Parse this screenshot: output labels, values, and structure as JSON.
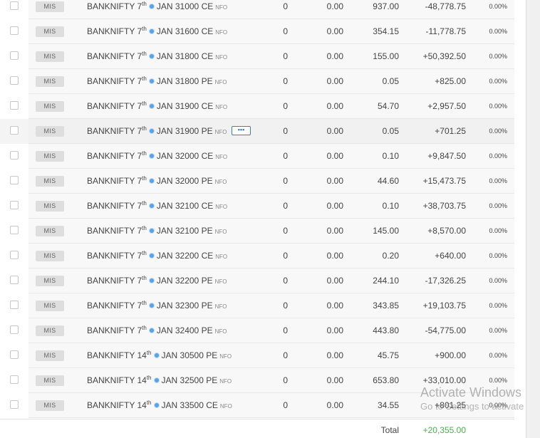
{
  "positions": [
    {
      "product": "MIS",
      "symbol": "BANKNIFTY",
      "day": "7",
      "suffix": "th",
      "month": "JAN",
      "strike": "31000",
      "opt": "CE",
      "exchange": "NFO",
      "qty": "0",
      "avg": "0.00",
      "ltp": "937.00",
      "pnl": "-48,778.75",
      "chg": "0.00%"
    },
    {
      "product": "MIS",
      "symbol": "BANKNIFTY",
      "day": "7",
      "suffix": "th",
      "month": "JAN",
      "strike": "31600",
      "opt": "CE",
      "exchange": "NFO",
      "qty": "0",
      "avg": "0.00",
      "ltp": "354.15",
      "pnl": "-11,778.75",
      "chg": "0.00%"
    },
    {
      "product": "MIS",
      "symbol": "BANKNIFTY",
      "day": "7",
      "suffix": "th",
      "month": "JAN",
      "strike": "31800",
      "opt": "CE",
      "exchange": "NFO",
      "qty": "0",
      "avg": "0.00",
      "ltp": "155.00",
      "pnl": "+50,392.50",
      "chg": "0.00%"
    },
    {
      "product": "MIS",
      "symbol": "BANKNIFTY",
      "day": "7",
      "suffix": "th",
      "month": "JAN",
      "strike": "31800",
      "opt": "PE",
      "exchange": "NFO",
      "qty": "0",
      "avg": "0.00",
      "ltp": "0.05",
      "pnl": "+825.00",
      "chg": "0.00%"
    },
    {
      "product": "MIS",
      "symbol": "BANKNIFTY",
      "day": "7",
      "suffix": "th",
      "month": "JAN",
      "strike": "31900",
      "opt": "CE",
      "exchange": "NFO",
      "qty": "0",
      "avg": "0.00",
      "ltp": "54.70",
      "pnl": "+2,957.50",
      "chg": "0.00%"
    },
    {
      "product": "MIS",
      "symbol": "BANKNIFTY",
      "day": "7",
      "suffix": "th",
      "month": "JAN",
      "strike": "31900",
      "opt": "PE",
      "exchange": "NFO",
      "qty": "0",
      "avg": "0.00",
      "ltp": "0.05",
      "pnl": "+701.25",
      "chg": "0.00%"
    },
    {
      "product": "MIS",
      "symbol": "BANKNIFTY",
      "day": "7",
      "suffix": "th",
      "month": "JAN",
      "strike": "32000",
      "opt": "CE",
      "exchange": "NFO",
      "qty": "0",
      "avg": "0.00",
      "ltp": "0.10",
      "pnl": "+9,847.50",
      "chg": "0.00%"
    },
    {
      "product": "MIS",
      "symbol": "BANKNIFTY",
      "day": "7",
      "suffix": "th",
      "month": "JAN",
      "strike": "32000",
      "opt": "PE",
      "exchange": "NFO",
      "qty": "0",
      "avg": "0.00",
      "ltp": "44.60",
      "pnl": "+15,473.75",
      "chg": "0.00%"
    },
    {
      "product": "MIS",
      "symbol": "BANKNIFTY",
      "day": "7",
      "suffix": "th",
      "month": "JAN",
      "strike": "32100",
      "opt": "CE",
      "exchange": "NFO",
      "qty": "0",
      "avg": "0.00",
      "ltp": "0.10",
      "pnl": "+38,703.75",
      "chg": "0.00%"
    },
    {
      "product": "MIS",
      "symbol": "BANKNIFTY",
      "day": "7",
      "suffix": "th",
      "month": "JAN",
      "strike": "32100",
      "opt": "PE",
      "exchange": "NFO",
      "qty": "0",
      "avg": "0.00",
      "ltp": "145.00",
      "pnl": "+8,570.00",
      "chg": "0.00%"
    },
    {
      "product": "MIS",
      "symbol": "BANKNIFTY",
      "day": "7",
      "suffix": "th",
      "month": "JAN",
      "strike": "32200",
      "opt": "CE",
      "exchange": "NFO",
      "qty": "0",
      "avg": "0.00",
      "ltp": "0.20",
      "pnl": "+640.00",
      "chg": "0.00%"
    },
    {
      "product": "MIS",
      "symbol": "BANKNIFTY",
      "day": "7",
      "suffix": "th",
      "month": "JAN",
      "strike": "32200",
      "opt": "PE",
      "exchange": "NFO",
      "qty": "0",
      "avg": "0.00",
      "ltp": "244.10",
      "pnl": "-17,326.25",
      "chg": "0.00%"
    },
    {
      "product": "MIS",
      "symbol": "BANKNIFTY",
      "day": "7",
      "suffix": "th",
      "month": "JAN",
      "strike": "32300",
      "opt": "PE",
      "exchange": "NFO",
      "qty": "0",
      "avg": "0.00",
      "ltp": "343.85",
      "pnl": "+19,103.75",
      "chg": "0.00%"
    },
    {
      "product": "MIS",
      "symbol": "BANKNIFTY",
      "day": "7",
      "suffix": "th",
      "month": "JAN",
      "strike": "32400",
      "opt": "PE",
      "exchange": "NFO",
      "qty": "0",
      "avg": "0.00",
      "ltp": "443.80",
      "pnl": "-54,775.00",
      "chg": "0.00%"
    },
    {
      "product": "MIS",
      "symbol": "BANKNIFTY",
      "day": "14",
      "suffix": "th",
      "month": "JAN",
      "strike": "30500",
      "opt": "PE",
      "exchange": "NFO",
      "qty": "0",
      "avg": "0.00",
      "ltp": "45.75",
      "pnl": "+900.00",
      "chg": "0.00%"
    },
    {
      "product": "MIS",
      "symbol": "BANKNIFTY",
      "day": "14",
      "suffix": "th",
      "month": "JAN",
      "strike": "32500",
      "opt": "PE",
      "exchange": "NFO",
      "qty": "0",
      "avg": "0.00",
      "ltp": "653.80",
      "pnl": "+33,010.00",
      "chg": "0.00%"
    },
    {
      "product": "MIS",
      "symbol": "BANKNIFTY",
      "day": "14",
      "suffix": "th",
      "month": "JAN",
      "strike": "33500",
      "opt": "CE",
      "exchange": "NFO",
      "qty": "0",
      "avg": "0.00",
      "ltp": "34.55",
      "pnl": "+801.25",
      "chg": "0.00%"
    }
  ],
  "hovered_row": 5,
  "more_button_label": "•••",
  "total": {
    "label": "Total",
    "value": "+20,355.00"
  },
  "watermark": {
    "line1": "Activate Windows",
    "line2": "Go to Settings to activate"
  },
  "colors": {
    "profit": "#4caf50",
    "accent": "#387ed1",
    "weekly_icon": "#5aa2e6"
  },
  "icons": {
    "weekly_expiry": "weekly-expiry-icon",
    "more": "more-options-icon"
  }
}
